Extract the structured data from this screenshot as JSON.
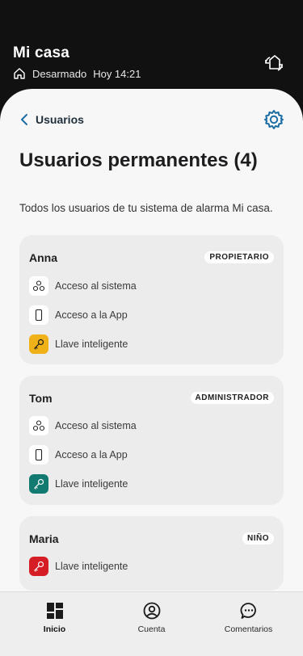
{
  "header": {
    "title": "Mi casa",
    "status": "Desarmado",
    "when": "Hoy 14:21"
  },
  "nav": {
    "back_label": "Usuarios"
  },
  "page": {
    "title": "Usuarios permanentes (4)",
    "subtitle": "Todos los usuarios de tu sistema de alarma Mi casa."
  },
  "users": [
    {
      "name": "Anna",
      "role": "PROPIETARIO",
      "rows": [
        "Acceso al sistema",
        "Acceso a la App",
        "Llave inteligente"
      ],
      "key_color": "#f0b017"
    },
    {
      "name": "Tom",
      "role": "ADMINISTRADOR",
      "rows": [
        "Acceso al sistema",
        "Acceso a la App",
        "Llave inteligente"
      ],
      "key_color": "#127a70"
    },
    {
      "name": "Maria",
      "role": "NIÑO",
      "rows": [
        "Llave inteligente"
      ],
      "key_color": "#d51d25"
    }
  ],
  "tabs": [
    {
      "label": "Inicio",
      "icon": "grid-icon"
    },
    {
      "label": "Cuenta",
      "icon": "account-icon"
    },
    {
      "label": "Comentarios",
      "icon": "chat-icon"
    }
  ],
  "colors": {
    "accent": "#1c6ea4",
    "background": "#111111"
  }
}
